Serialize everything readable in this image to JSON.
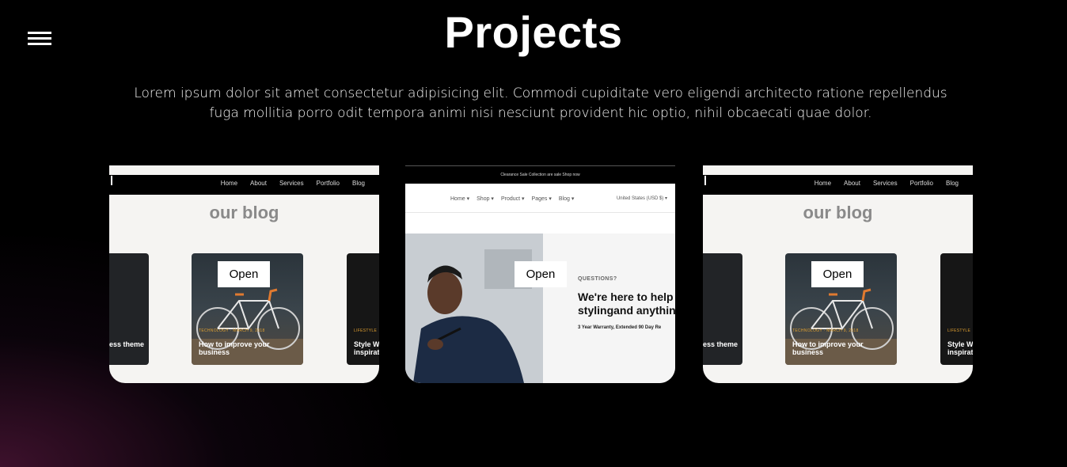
{
  "page": {
    "title": "Projects",
    "description": "Lorem ipsum dolor sit amet consectetur adipisicing elit. Commodi cupiditate vero eligendi architecto ratione repellendus fuga mollitia porro odit tempora animi nisi nesciunt provident hic optio, nihil obcaecati quae dolor."
  },
  "menu": {
    "icon": "hamburger-icon"
  },
  "colors": {
    "background": "#000000",
    "glow": "#481434",
    "button_bg": "#ffffff",
    "accent": "#e0a030"
  },
  "cards": [
    {
      "open_label": "Open",
      "nav_links": [
        "Home",
        "About",
        "Services",
        "Portfolio",
        "Blog"
      ],
      "heading": "our blog",
      "posts": [
        {
          "title": "ess theme",
          "meta": ""
        },
        {
          "title": "How to improve your business",
          "meta": "TECHNOLOGY · MARCH 9, 2018"
        },
        {
          "title": "Style W inspirat",
          "meta": "LIFESTYLE"
        }
      ]
    },
    {
      "open_label": "Open",
      "announcement": "Clearance Sale Collection are sale Shop now",
      "nav_links": [
        "Home ▾",
        "Shop ▾",
        "Product ▾",
        "Pages ▾",
        "Blog ▾"
      ],
      "currency": "United States (USD $) ▾",
      "eyebrow": "QUESTIONS?",
      "headline_line1": "We're here to help",
      "headline_line2": "stylingand anythin",
      "subline": "3 Year Warranty, Extended 90 Day Re"
    },
    {
      "open_label": "Open",
      "nav_links": [
        "Home",
        "About",
        "Services",
        "Portfolio",
        "Blog"
      ],
      "heading": "our blog",
      "posts": [
        {
          "title": "ess theme",
          "meta": ""
        },
        {
          "title": "How to improve your business",
          "meta": "TECHNOLOGY · MARCH 9, 2018"
        },
        {
          "title": "Style W inspirat",
          "meta": "LIFESTYLE"
        }
      ]
    }
  ]
}
